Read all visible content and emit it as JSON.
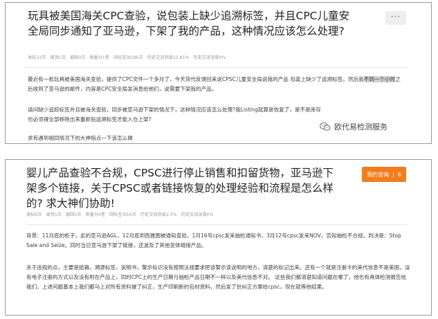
{
  "card1": {
    "title": "玩具被美国海关CPC查验，说包装上缺少追溯标签，并且CPC儿童安全局同步通知了亚马逊，下架了我的产品，这种情况应该怎么处理?",
    "more_label": "···",
    "meta": [
      "发帖33次",
      "被顶1次",
      "被踩0次",
      "质量分1星",
      "回帖互动186次",
      "历史交流热度15.81%",
      "历史交流深度0%"
    ],
    "para1_before": "最近有一批玩具被美国海关查验，提供了CPC文件一个多月了，今天货代反馈回来说CPSC儿童安全局说我的产品 包装上缺少了追溯标签。然后我",
    "para1_highlight": "不到一个小时",
    "para1_after": "之后收到了亚马逊的邮件，内容是CPC安全局发消息给他们，说需要下架我的产品。",
    "para2": "请问缺少追踪标签并且被海关查验，同步被亚马逊下架的情况下，这种情况应该怎么处理?我Listing就算是恢复了，是不是库存也必须得全部移除出来重新贴追溯标签才能入仓上架?",
    "para3": "求有遇到相同情况下的大神指点一下该怎么做",
    "watermark": "欧代易检测服务"
  },
  "card2": {
    "title": "婴儿产品查验不合规，CPSC进行停止销售和扣留货物，亚马逊下架多个链接，关于CPSC或者链接恢复的处理经验和流程是怎么样的? 求大神们协助!",
    "badge_label": "预约咨询",
    "badge_sep": "|",
    "badge_count": "6",
    "meta": [
      "发帖6次",
      "被顶1次",
      "被踩0次",
      "质量分0星",
      "回帖互动16次",
      "历史交流热度2.5%",
      "历史交流深度0%"
    ],
    "para1": "背景：11月底的柜子，走的亚马逊AGL，12月底到西雅图被通知查验，1月16号cpsc发来抽检通知书，3月12号cpsc发来NOV，告知抽检不合规，判决是：Stop Sale and Seize。同时当日亚马逊下架了链接，还波及了其他变体链接产品。",
    "para2": "关于违规的点，主要是纸箱，溯源标签，说明书，警示标识没有按照法规要求把该警示该说明的地方，清楚的标记出来。还有一个就是注册卡的美代信息不是美国，没有电子注册的方式以及没有附在产品上，同时CPC上的生产日期与抽检产品日期不一样以及美代信息不对。 这些我们都清楚知道问题在哪了，他也有具体检测报告给我们，上述问题基本上我们都马上对所有资料做了纠正，生产印刷新的包材资料，然后发了份纠正方案给cpsc，现在就等他结果。"
  }
}
